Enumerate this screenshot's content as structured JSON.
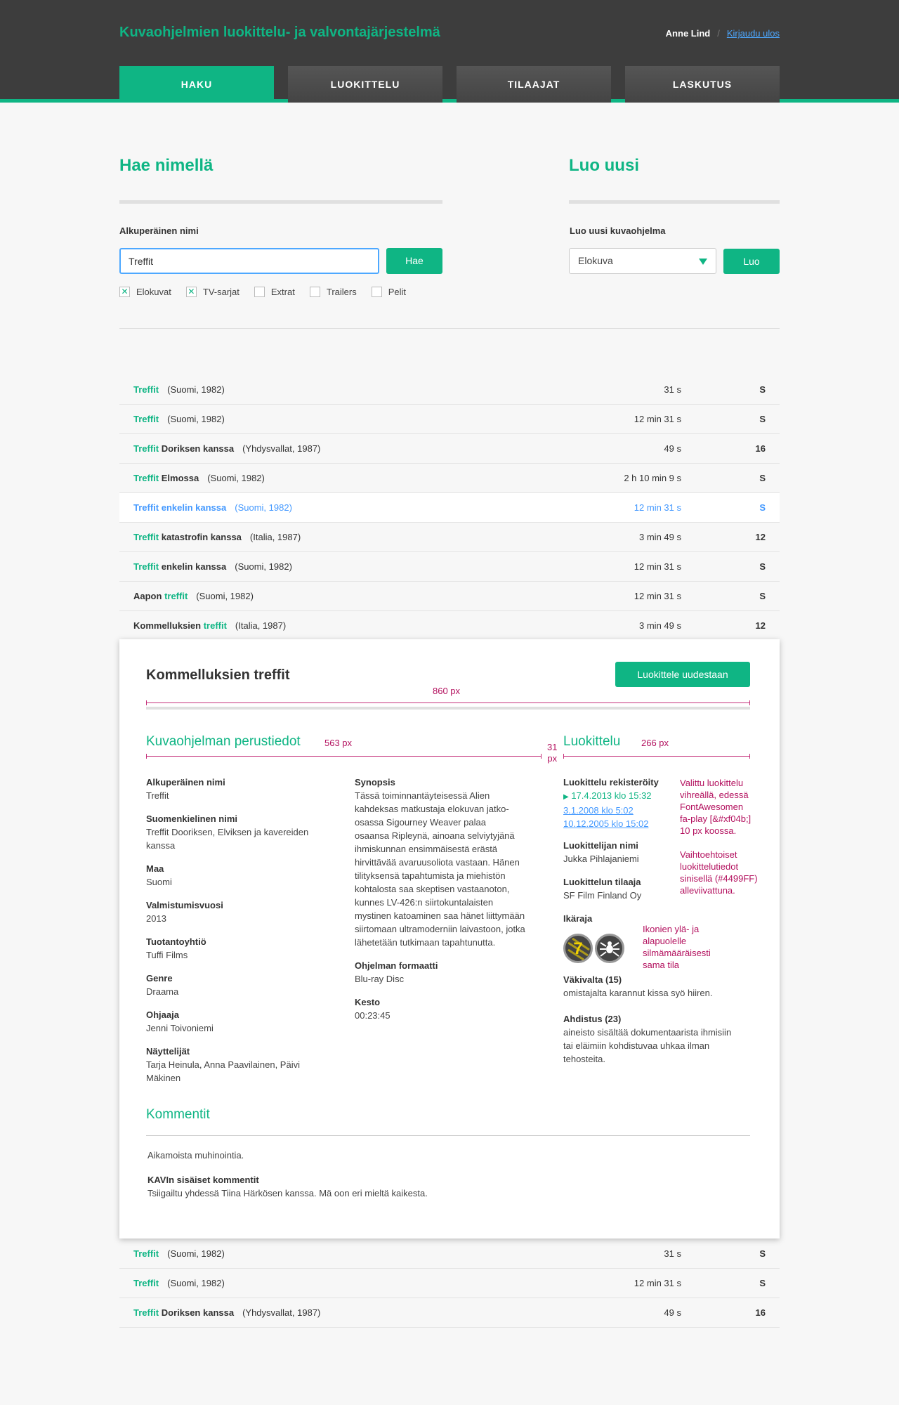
{
  "header": {
    "app_title": "Kuvaohjelmien luokittelu- ja valvontajärjestelmä",
    "user_name": "Anne Lind",
    "separator": "/",
    "logout": "Kirjaudu ulos",
    "tabs": [
      "HAKU",
      "LUOKITTELU",
      "TILAAJAT",
      "LASKUTUS"
    ]
  },
  "search": {
    "heading": "Hae nimellä",
    "label": "Alkuperäinen nimi",
    "value": "Treffit",
    "button": "Hae",
    "filters": [
      {
        "label": "Elokuvat",
        "checked": true
      },
      {
        "label": "TV-sarjat",
        "checked": true
      },
      {
        "label": "Extrat",
        "checked": false
      },
      {
        "label": "Trailers",
        "checked": false
      },
      {
        "label": "Pelit",
        "checked": false
      }
    ]
  },
  "create": {
    "heading": "Luo uusi",
    "label": "Luo uusi kuvaohjelma",
    "select_value": "Elokuva",
    "button": "Luo"
  },
  "results": [
    {
      "hl": "Treffit",
      "rest": "",
      "meta": "(Suomi, 1982)",
      "duration": "31 s",
      "age": "S"
    },
    {
      "hl": "Treffit",
      "rest": "",
      "meta": "(Suomi, 1982)",
      "duration": "12 min 31 s",
      "age": "S"
    },
    {
      "hl": "Treffit",
      "rest": " Doriksen kanssa",
      "meta": "(Yhdysvallat, 1987)",
      "duration": "49 s",
      "age": "16"
    },
    {
      "hl": "Treffit",
      "rest": " Elmossa",
      "meta": "(Suomi, 1982)",
      "duration": "2 h 10 min 9 s",
      "age": "S"
    },
    {
      "hl": "Treffit",
      "rest": " enkelin kanssa",
      "meta": "(Suomi, 1982)",
      "duration": "12 min 31 s",
      "age": "S"
    },
    {
      "hl": "Treffit",
      "rest": " katastrofin kanssa",
      "meta": "(Italia, 1987)",
      "duration": "3 min 49 s",
      "age": "12"
    },
    {
      "hl": "Treffit",
      "rest": " enkelin kanssa",
      "meta": "(Suomi, 1982)",
      "duration": "12 min 31 s",
      "age": "S"
    },
    {
      "pre": "Aapon ",
      "hl": "treffit",
      "rest": "",
      "meta": "(Suomi, 1982)",
      "duration": "12 min 31 s",
      "age": "S"
    },
    {
      "pre": "Kommelluksien ",
      "hl": "treffit",
      "rest": "",
      "meta": "(Italia, 1987)",
      "duration": "3 min 49 s",
      "age": "12"
    }
  ],
  "results_after": [
    {
      "hl": "Treffit",
      "rest": "",
      "meta": "(Suomi, 1982)",
      "duration": "31 s",
      "age": "S"
    },
    {
      "hl": "Treffit",
      "rest": "",
      "meta": "(Suomi, 1982)",
      "duration": "12 min 31 s",
      "age": "S"
    },
    {
      "hl": "Treffit",
      "rest": " Doriksen kanssa",
      "meta": "(Yhdysvallat, 1987)",
      "duration": "49 s",
      "age": "16"
    }
  ],
  "detail": {
    "title": "Kommelluksien treffit",
    "reclassify": "Luokittele uudestaan",
    "dim_total": "860 px",
    "dim_left": "563 px",
    "dim_gap": "31\npx",
    "dim_right": "266 px",
    "basic_heading": "Kuvaohjelman perustiedot",
    "class_heading": "Luokittelu",
    "fields_left": [
      {
        "label": "Alkuperäinen nimi",
        "value": "Treffit"
      },
      {
        "label": "Suomenkielinen nimi",
        "value": "Treffit Dooriksen, Elviksen ja kavereiden\nkanssa"
      },
      {
        "label": "Maa",
        "value": "Suomi"
      },
      {
        "label": "Valmistumisvuosi",
        "value": "2013"
      },
      {
        "label": "Tuotantoyhtiö",
        "value": "Tuffi Films"
      },
      {
        "label": "Genre",
        "value": "Draama"
      },
      {
        "label": "Ohjaaja",
        "value": "Jenni Toivoniemi"
      },
      {
        "label": "Näyttelijät",
        "value": "Tarja Heinula, Anna Paavilainen, Päivi\nMäkinen"
      }
    ],
    "synopsis_label": "Synopsis",
    "synopsis": "Tässä toiminnantäyteisessä Alien\nkahdeksas matkustaja elokuvan jatko-\nosassa Sigourney Weaver palaa\nosaansa Ripleynä, ainoana selviytyjänä\nihmiskunnan ensimmäisestä erästä\nhirvittävää avaruusoliota vastaan. Hänen\ntilityksensä tapahtumista ja miehistön\nkohtalosta saa skeptisen vastaanoton,\nkunnes LV-426:n siirtokuntalaisten\nmystinen katoaminen saa hänet liittymään\nsiirtomaan ultramoderniin laivastoon, jotka\nlähetetään tutkimaan tapahtunutta.",
    "format_label": "Ohjelman formaatti",
    "format": "Blu-ray Disc",
    "duration_label": "Kesto",
    "duration": "00:23:45",
    "registered_label": "Luokittelu rekisteröity",
    "registered_current": "17.4.2013 klo 15:32",
    "registered_alt": [
      "3.1.2008 klo 5:02",
      "10.12.2005 klo 15:02"
    ],
    "classifier_label": "Luokittelijan nimi",
    "classifier": "Jukka Pihlajaniemi",
    "orderer_label": "Luokittelun tilaaja",
    "orderer": "SF Film Finland Oy",
    "age_label": "Ikäraja",
    "age_value": "7",
    "criteria": [
      {
        "label": "Väkivalta (15)",
        "value": "omistajalta karannut kissa syö hiiren."
      },
      {
        "label": "Ahdistus (23)",
        "value": "aineisto sisältää dokumentaarista ihmisiin\ntai eläimiin kohdistuvaa uhkaa ilman\ntehosteita."
      }
    ],
    "note1": "Valittu luokittelu\nvihreällä, edessä\nFontAwesomen\nfa-play [&#xf04b;]\n10 px koossa.",
    "note2": "Vaihtoehtoiset\nluokittelutiedot\nsinisellä (#4499FF)\nalleviivattuna.",
    "note3": "Ikonien ylä- ja\nalapuolelle\nsilmämääräisesti\nsama tila",
    "comments_heading": "Kommentit",
    "comment": "Aikamoista muhinointia.",
    "internal_label": "KAVIn sisäiset kommentit",
    "internal": "Tsiigailtu yhdessä Tiina Härkösen kanssa. Mä oon eri mieltä kaikesta."
  },
  "colors": {
    "accent": "#0fb584",
    "alt_blue": "#4499ff",
    "annotation": "#b3105e",
    "header_bg": "#3d3d3d"
  }
}
